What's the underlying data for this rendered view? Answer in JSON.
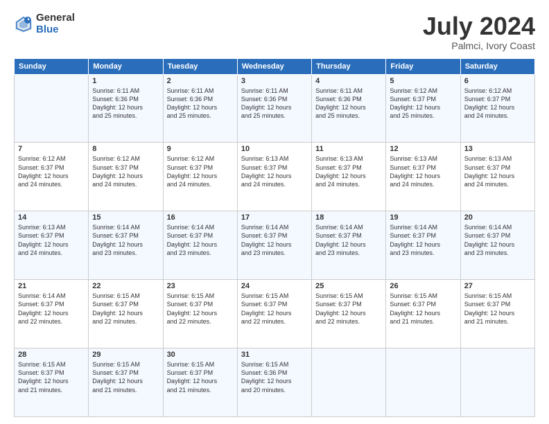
{
  "header": {
    "logo_general": "General",
    "logo_blue": "Blue",
    "title": "July 2024",
    "location": "Palmci, Ivory Coast"
  },
  "days_of_week": [
    "Sunday",
    "Monday",
    "Tuesday",
    "Wednesday",
    "Thursday",
    "Friday",
    "Saturday"
  ],
  "weeks": [
    [
      {
        "day": "",
        "info": ""
      },
      {
        "day": "1",
        "info": "Sunrise: 6:11 AM\nSunset: 6:36 PM\nDaylight: 12 hours\nand 25 minutes."
      },
      {
        "day": "2",
        "info": "Sunrise: 6:11 AM\nSunset: 6:36 PM\nDaylight: 12 hours\nand 25 minutes."
      },
      {
        "day": "3",
        "info": "Sunrise: 6:11 AM\nSunset: 6:36 PM\nDaylight: 12 hours\nand 25 minutes."
      },
      {
        "day": "4",
        "info": "Sunrise: 6:11 AM\nSunset: 6:36 PM\nDaylight: 12 hours\nand 25 minutes."
      },
      {
        "day": "5",
        "info": "Sunrise: 6:12 AM\nSunset: 6:37 PM\nDaylight: 12 hours\nand 25 minutes."
      },
      {
        "day": "6",
        "info": "Sunrise: 6:12 AM\nSunset: 6:37 PM\nDaylight: 12 hours\nand 24 minutes."
      }
    ],
    [
      {
        "day": "7",
        "info": ""
      },
      {
        "day": "8",
        "info": "Sunrise: 6:12 AM\nSunset: 6:37 PM\nDaylight: 12 hours\nand 24 minutes."
      },
      {
        "day": "9",
        "info": "Sunrise: 6:12 AM\nSunset: 6:37 PM\nDaylight: 12 hours\nand 24 minutes."
      },
      {
        "day": "10",
        "info": "Sunrise: 6:13 AM\nSunset: 6:37 PM\nDaylight: 12 hours\nand 24 minutes."
      },
      {
        "day": "11",
        "info": "Sunrise: 6:13 AM\nSunset: 6:37 PM\nDaylight: 12 hours\nand 24 minutes."
      },
      {
        "day": "12",
        "info": "Sunrise: 6:13 AM\nSunset: 6:37 PM\nDaylight: 12 hours\nand 24 minutes."
      },
      {
        "day": "13",
        "info": "Sunrise: 6:13 AM\nSunset: 6:37 PM\nDaylight: 12 hours\nand 24 minutes."
      }
    ],
    [
      {
        "day": "14",
        "info": ""
      },
      {
        "day": "15",
        "info": "Sunrise: 6:14 AM\nSunset: 6:37 PM\nDaylight: 12 hours\nand 23 minutes."
      },
      {
        "day": "16",
        "info": "Sunrise: 6:14 AM\nSunset: 6:37 PM\nDaylight: 12 hours\nand 23 minutes."
      },
      {
        "day": "17",
        "info": "Sunrise: 6:14 AM\nSunset: 6:37 PM\nDaylight: 12 hours\nand 23 minutes."
      },
      {
        "day": "18",
        "info": "Sunrise: 6:14 AM\nSunset: 6:37 PM\nDaylight: 12 hours\nand 23 minutes."
      },
      {
        "day": "19",
        "info": "Sunrise: 6:14 AM\nSunset: 6:37 PM\nDaylight: 12 hours\nand 23 minutes."
      },
      {
        "day": "20",
        "info": "Sunrise: 6:14 AM\nSunset: 6:37 PM\nDaylight: 12 hours\nand 23 minutes."
      }
    ],
    [
      {
        "day": "21",
        "info": ""
      },
      {
        "day": "22",
        "info": "Sunrise: 6:15 AM\nSunset: 6:37 PM\nDaylight: 12 hours\nand 22 minutes."
      },
      {
        "day": "23",
        "info": "Sunrise: 6:15 AM\nSunset: 6:37 PM\nDaylight: 12 hours\nand 22 minutes."
      },
      {
        "day": "24",
        "info": "Sunrise: 6:15 AM\nSunset: 6:37 PM\nDaylight: 12 hours\nand 22 minutes."
      },
      {
        "day": "25",
        "info": "Sunrise: 6:15 AM\nSunset: 6:37 PM\nDaylight: 12 hours\nand 22 minutes."
      },
      {
        "day": "26",
        "info": "Sunrise: 6:15 AM\nSunset: 6:37 PM\nDaylight: 12 hours\nand 21 minutes."
      },
      {
        "day": "27",
        "info": "Sunrise: 6:15 AM\nSunset: 6:37 PM\nDaylight: 12 hours\nand 21 minutes."
      }
    ],
    [
      {
        "day": "28",
        "info": "Sunrise: 6:15 AM\nSunset: 6:37 PM\nDaylight: 12 hours\nand 21 minutes."
      },
      {
        "day": "29",
        "info": "Sunrise: 6:15 AM\nSunset: 6:37 PM\nDaylight: 12 hours\nand 21 minutes."
      },
      {
        "day": "30",
        "info": "Sunrise: 6:15 AM\nSunset: 6:37 PM\nDaylight: 12 hours\nand 21 minutes."
      },
      {
        "day": "31",
        "info": "Sunrise: 6:15 AM\nSunset: 6:36 PM\nDaylight: 12 hours\nand 20 minutes."
      },
      {
        "day": "",
        "info": ""
      },
      {
        "day": "",
        "info": ""
      },
      {
        "day": "",
        "info": ""
      }
    ]
  ],
  "week_day_info": {
    "7": "Sunrise: 6:12 AM\nSunset: 6:37 PM\nDaylight: 12 hours\nand 24 minutes.",
    "14": "Sunrise: 6:13 AM\nSunset: 6:37 PM\nDaylight: 12 hours\nand 24 minutes.",
    "21": "Sunrise: 6:14 AM\nSunset: 6:37 PM\nDaylight: 12 hours\nand 22 minutes."
  }
}
